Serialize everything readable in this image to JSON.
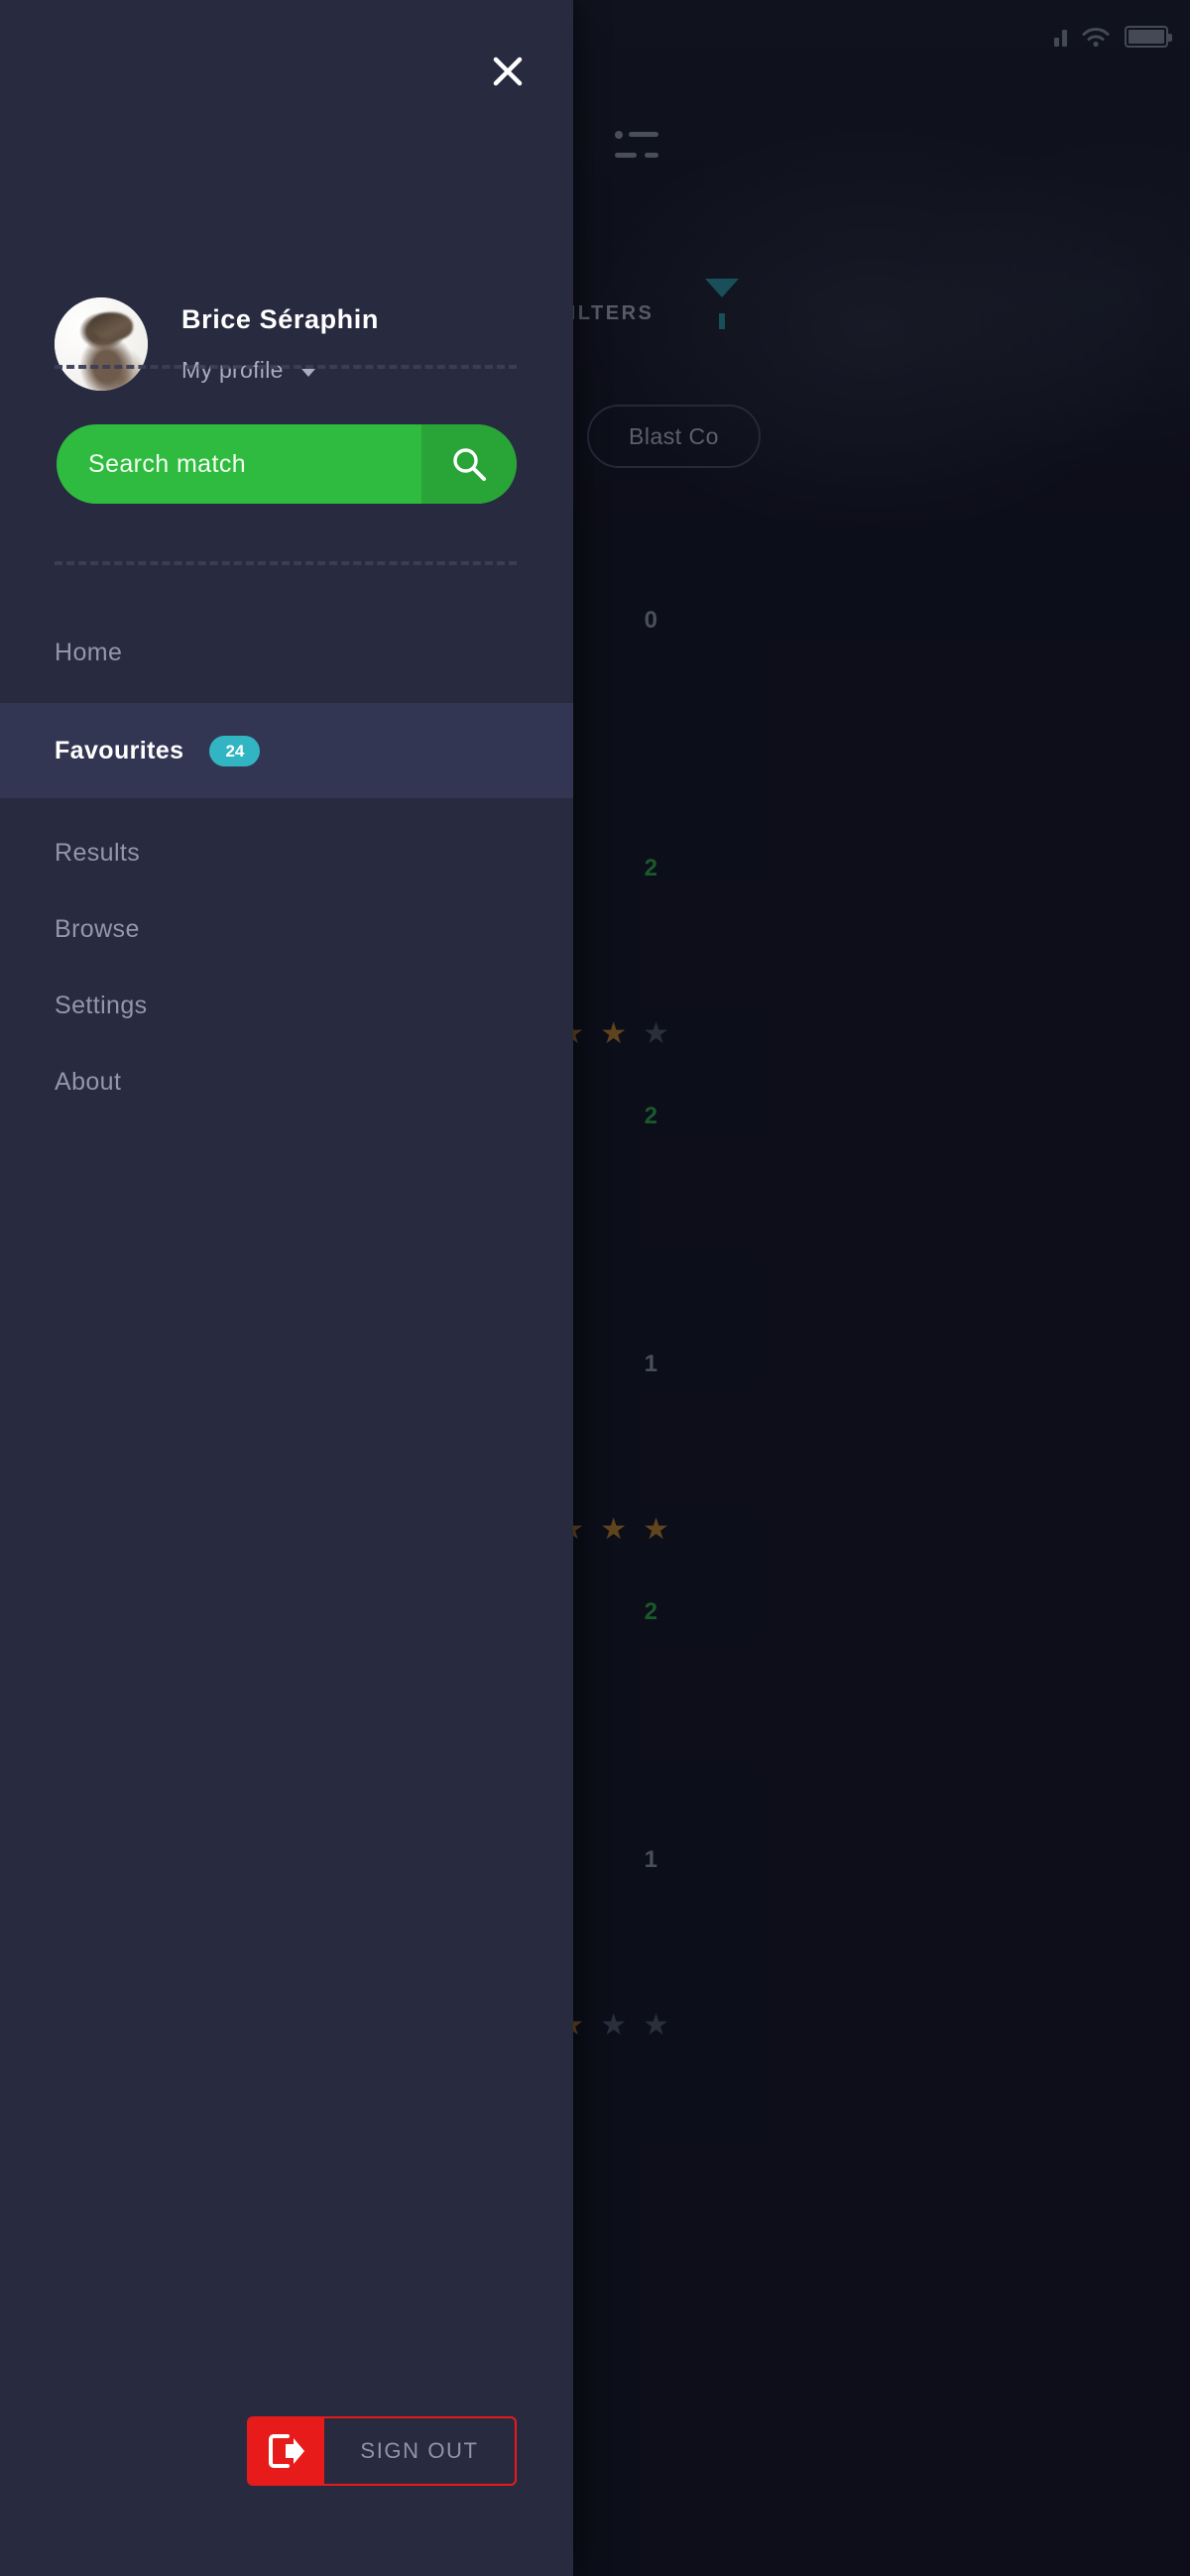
{
  "status_bar": {
    "signal_icon": "signal-bars-icon",
    "wifi_icon": "wifi-icon",
    "battery_icon": "battery-full-icon"
  },
  "background_app": {
    "menu_icon": "list-menu-icon",
    "filters_label": "FILTERS",
    "filter_icon": "funnel-icon",
    "competition_pill": "Blast Co",
    "rows": [
      {
        "score": "0",
        "score_state": "zero",
        "stars": [
          "on",
          "on",
          "off"
        ]
      },
      {
        "score": "2",
        "score_state": "win",
        "stars": [
          "on",
          "on",
          "off"
        ]
      },
      {
        "score": "2",
        "score_state": "win",
        "stars": [
          "on",
          "on",
          "on"
        ]
      },
      {
        "score": "1",
        "score_state": "one",
        "stars": [
          "on",
          "on",
          "on"
        ]
      },
      {
        "score": "2",
        "score_state": "win",
        "stars": [
          "on",
          "off",
          "off"
        ]
      },
      {
        "score": "1",
        "score_state": "one",
        "stars": [
          "on",
          "off",
          "off"
        ]
      }
    ]
  },
  "drawer": {
    "close_icon": "close-icon",
    "profile": {
      "avatar_icon": "user-avatar",
      "name": "Brice Séraphin",
      "subtitle": "My profile",
      "chevron_icon": "chevron-down-icon"
    },
    "search": {
      "label": "Search match",
      "icon": "search-icon",
      "accent_color": "#2fbb3f"
    },
    "nav_items": [
      {
        "label": "Home",
        "active": false,
        "badge": null
      },
      {
        "label": "Favourites",
        "active": true,
        "badge": "24"
      },
      {
        "label": "Results",
        "active": false,
        "badge": null
      },
      {
        "label": "Browse",
        "active": false,
        "badge": null
      },
      {
        "label": "Settings",
        "active": false,
        "badge": null
      },
      {
        "label": "About",
        "active": false,
        "badge": null
      }
    ],
    "sign_out": {
      "label": "SIGN OUT",
      "icon": "logout-icon",
      "accent_color": "#e81b1b"
    },
    "badge_color": "#32b5c2",
    "background_color": "#282a40",
    "active_item_color": "#333652"
  }
}
